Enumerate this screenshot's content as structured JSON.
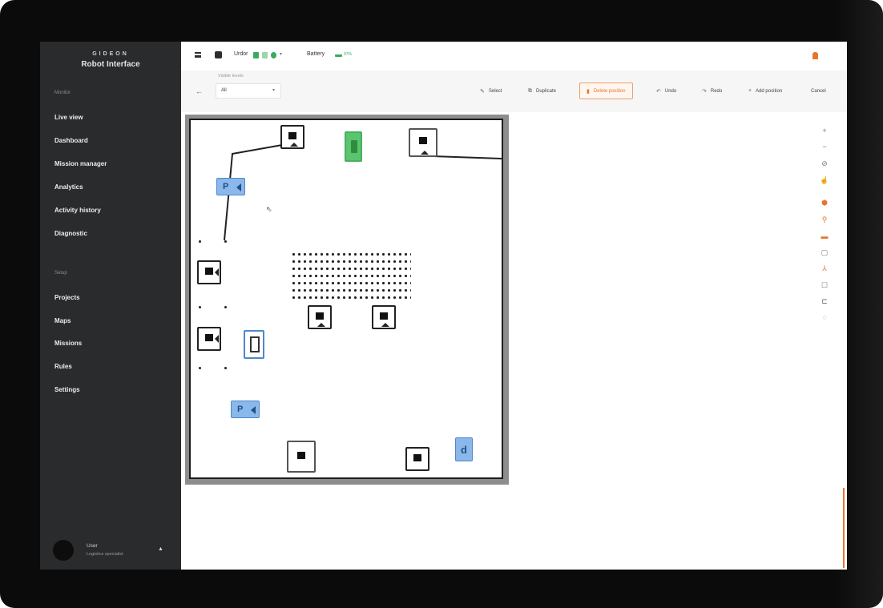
{
  "sidebar": {
    "brand_logo": "GIDEON",
    "app_name": "Robot Interface",
    "section_monitor": "Monitor",
    "monitor_items": [
      "Live view",
      "Dashboard",
      "Mission manager",
      "Analytics",
      "Activity history",
      "Diagnostic"
    ],
    "section_setup": "Setup",
    "setup_items": [
      "Projects",
      "Maps",
      "Missions",
      "Rules",
      "Settings"
    ],
    "user_name": "User",
    "user_role": "Logistics specialist"
  },
  "topbar": {
    "robot_name": "Urdor",
    "battery_label": "Battery",
    "battery_percent": "97%",
    "status_colors": [
      "#3aaa5c",
      "#9fd3aa",
      "#3aaa5c"
    ]
  },
  "toolbar": {
    "layer_label": "Visible levels",
    "layer_value": "All",
    "select_label": "Select",
    "duplicate_label": "Duplicate",
    "delete_label": "Delete position",
    "undo_label": "Undo",
    "redo_label": "Redo",
    "add_position_label": "Add position",
    "cancel_label": "Cancel"
  },
  "map": {
    "parking_label": "P",
    "charger_b_label": "d",
    "accent_colors": {
      "parking": "#8bb8ea",
      "charger": "#5bc46e",
      "danger": "#e8742f"
    }
  },
  "rail": {
    "icons": [
      "plus-icon",
      "minus-icon",
      "compass-icon",
      "hand-icon",
      "location-icon",
      "pin-icon",
      "area-icon",
      "rectangle-icon",
      "robot-icon",
      "note-icon",
      "layers-icon",
      "settings-icon"
    ]
  }
}
